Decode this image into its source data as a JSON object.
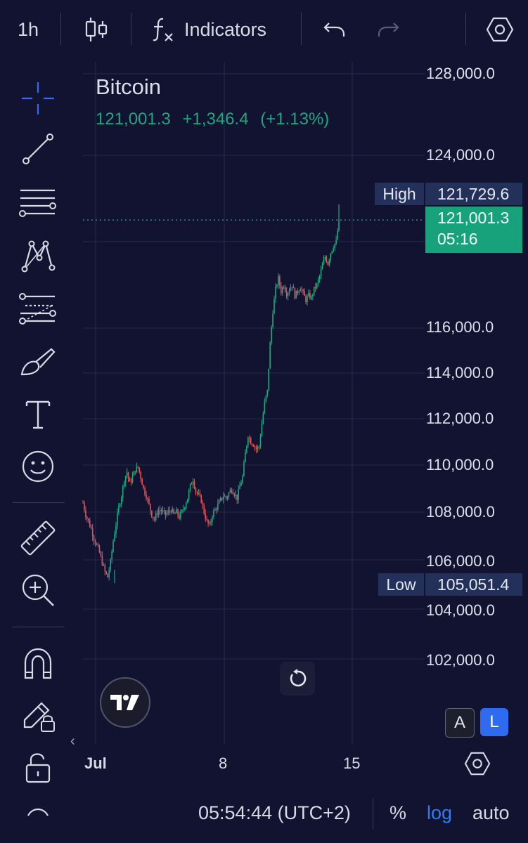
{
  "toolbar": {
    "interval": "1h",
    "indicators_label": "Indicators",
    "icons": [
      "candles-icon",
      "function-icon",
      "undo-icon",
      "redo-icon",
      "settings-hexagon-icon"
    ]
  },
  "sidebar": {
    "tools": [
      "crosshair-icon",
      "trendline-icon",
      "fib-retracement-icon",
      "pattern-icon",
      "projection-icon",
      "brush-icon",
      "text-icon",
      "emoji-icon",
      "ruler-icon",
      "zoom-icon",
      "magnet-icon",
      "lock-drawing-icon",
      "unlock-icon"
    ]
  },
  "legend": {
    "symbol": "Bitcoin",
    "price": "121,001.3",
    "change": "+1,346.4",
    "change_pct": "(+1.13%)"
  },
  "price_scale": {
    "labels": [
      "128,000.0",
      "124,000.0",
      "116,000.0",
      "114,000.0",
      "112,000.0",
      "110,000.0",
      "108,000.0",
      "106,000.0",
      "104,000.0",
      "102,000.0"
    ],
    "high_label": "High",
    "high_value": "121,729.6",
    "low_label": "Low",
    "low_value": "105,051.4",
    "current_value": "121,001.3",
    "countdown": "05:16"
  },
  "time_scale": {
    "labels": [
      "Jul",
      "8",
      "15"
    ]
  },
  "scale_buttons": {
    "a": "A",
    "l": "L"
  },
  "bottom": {
    "clock": "05:54:44 (UTC+2)",
    "percent": "%",
    "log": "log",
    "auto": "auto"
  },
  "colors": {
    "background": "#121330",
    "up": "#1fa782",
    "down": "#e0535a",
    "accent": "#2f6bf0",
    "tag": "#22305a"
  },
  "chart_data": {
    "type": "candlestick",
    "interval": "1h",
    "ylim": [
      100000,
      129500
    ],
    "log_scale": true,
    "grid": true,
    "x_ticks": [
      "Jul",
      "8",
      "15"
    ],
    "high": 121729.6,
    "low": 105051.4,
    "last": 121001.3,
    "series": [
      {
        "t": 0,
        "v": 108400
      },
      {
        "t": 4,
        "v": 107900
      },
      {
        "t": 8,
        "v": 107600
      },
      {
        "t": 12,
        "v": 107300
      },
      {
        "t": 16,
        "v": 106900
      },
      {
        "t": 20,
        "v": 106600
      },
      {
        "t": 24,
        "v": 106300
      },
      {
        "t": 28,
        "v": 105900
      },
      {
        "t": 32,
        "v": 105500
      },
      {
        "t": 36,
        "v": 105300
      },
      {
        "t": 40,
        "v": 105900
      },
      {
        "t": 44,
        "v": 106800
      },
      {
        "t": 48,
        "v": 107500
      },
      {
        "t": 52,
        "v": 108200
      },
      {
        "t": 56,
        "v": 108700
      },
      {
        "t": 60,
        "v": 109400
      },
      {
        "t": 64,
        "v": 109700
      },
      {
        "t": 68,
        "v": 109200
      },
      {
        "t": 72,
        "v": 109500
      },
      {
        "t": 76,
        "v": 109800
      },
      {
        "t": 80,
        "v": 109900
      },
      {
        "t": 84,
        "v": 109500
      },
      {
        "t": 88,
        "v": 109000
      },
      {
        "t": 92,
        "v": 108700
      },
      {
        "t": 96,
        "v": 108300
      },
      {
        "t": 100,
        "v": 107900
      },
      {
        "t": 104,
        "v": 107700
      },
      {
        "t": 108,
        "v": 108000
      },
      {
        "t": 112,
        "v": 108100
      },
      {
        "t": 116,
        "v": 108000
      },
      {
        "t": 120,
        "v": 107900
      },
      {
        "t": 124,
        "v": 108000
      },
      {
        "t": 128,
        "v": 108100
      },
      {
        "t": 132,
        "v": 107900
      },
      {
        "t": 136,
        "v": 108000
      },
      {
        "t": 140,
        "v": 107800
      },
      {
        "t": 144,
        "v": 108000
      },
      {
        "t": 148,
        "v": 108300
      },
      {
        "t": 152,
        "v": 108600
      },
      {
        "t": 156,
        "v": 109100
      },
      {
        "t": 160,
        "v": 109400
      },
      {
        "t": 164,
        "v": 108900
      },
      {
        "t": 168,
        "v": 108700
      },
      {
        "t": 172,
        "v": 108500
      },
      {
        "t": 176,
        "v": 108000
      },
      {
        "t": 180,
        "v": 107600
      },
      {
        "t": 184,
        "v": 107400
      },
      {
        "t": 188,
        "v": 107900
      },
      {
        "t": 192,
        "v": 108100
      },
      {
        "t": 196,
        "v": 108300
      },
      {
        "t": 200,
        "v": 108500
      },
      {
        "t": 204,
        "v": 108700
      },
      {
        "t": 208,
        "v": 108600
      },
      {
        "t": 212,
        "v": 108800
      },
      {
        "t": 216,
        "v": 109000
      },
      {
        "t": 220,
        "v": 108800
      },
      {
        "t": 224,
        "v": 108600
      },
      {
        "t": 228,
        "v": 109100
      },
      {
        "t": 232,
        "v": 109500
      },
      {
        "t": 236,
        "v": 110500
      },
      {
        "t": 240,
        "v": 111300
      },
      {
        "t": 244,
        "v": 111000
      },
      {
        "t": 248,
        "v": 110900
      },
      {
        "t": 252,
        "v": 110700
      },
      {
        "t": 256,
        "v": 110800
      },
      {
        "t": 260,
        "v": 111800
      },
      {
        "t": 264,
        "v": 112700
      },
      {
        "t": 268,
        "v": 113200
      },
      {
        "t": 272,
        "v": 115300
      },
      {
        "t": 276,
        "v": 116800
      },
      {
        "t": 280,
        "v": 117800
      },
      {
        "t": 284,
        "v": 118300
      },
      {
        "t": 288,
        "v": 117700
      },
      {
        "t": 292,
        "v": 118000
      },
      {
        "t": 296,
        "v": 117600
      },
      {
        "t": 300,
        "v": 117800
      },
      {
        "t": 304,
        "v": 118000
      },
      {
        "t": 308,
        "v": 117500
      },
      {
        "t": 312,
        "v": 117700
      },
      {
        "t": 316,
        "v": 117900
      },
      {
        "t": 320,
        "v": 117600
      },
      {
        "t": 324,
        "v": 117300
      },
      {
        "t": 328,
        "v": 117500
      },
      {
        "t": 332,
        "v": 117400
      },
      {
        "t": 336,
        "v": 117800
      },
      {
        "t": 340,
        "v": 118000
      },
      {
        "t": 344,
        "v": 118400
      },
      {
        "t": 348,
        "v": 118900
      },
      {
        "t": 352,
        "v": 119300
      },
      {
        "t": 356,
        "v": 119000
      },
      {
        "t": 360,
        "v": 119500
      },
      {
        "t": 364,
        "v": 119800
      },
      {
        "t": 368,
        "v": 120000
      },
      {
        "t": 372,
        "v": 121001.3
      }
    ]
  }
}
